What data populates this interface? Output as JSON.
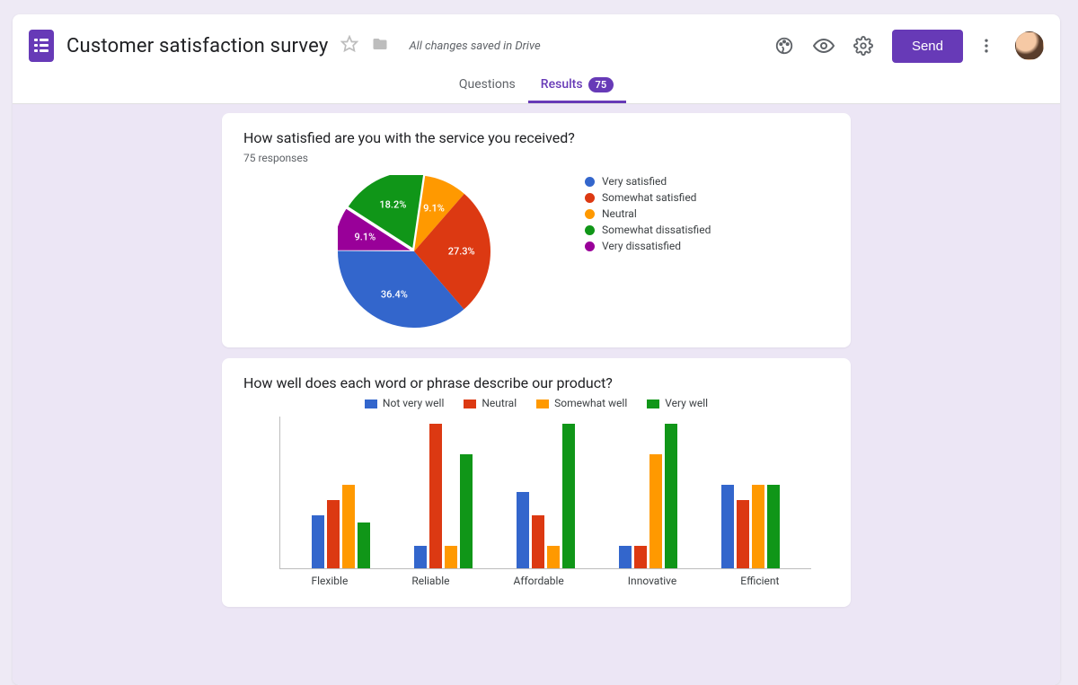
{
  "header": {
    "title": "Customer satisfaction survey",
    "save_status": "All changes saved in Drive",
    "send_label": "Send"
  },
  "tabs": {
    "questions": "Questions",
    "results": "Results",
    "results_badge": "75"
  },
  "q1": {
    "title": "How satisfied are you with the service you received?",
    "responses_label": "75 responses"
  },
  "q2": {
    "title": "How well does each word or phrase describe our product?"
  },
  "colors": {
    "blue": "#3366cc",
    "red": "#dc3912",
    "orange": "#ff9900",
    "green": "#109618",
    "purple": "#990099"
  },
  "chart_data": [
    {
      "type": "pie",
      "title": "How satisfied are you with the service you received?",
      "series": [
        {
          "name": "Very satisfied",
          "value": 36.4,
          "color": "blue",
          "label": "36.4%"
        },
        {
          "name": "Somewhat satisfied",
          "value": 27.3,
          "color": "red",
          "label": "27.3%"
        },
        {
          "name": "Neutral",
          "value": 9.1,
          "color": "orange",
          "label": "9.1%"
        },
        {
          "name": "Somewhat dissatisfied",
          "value": 18.2,
          "color": "green",
          "label": "18.2%"
        },
        {
          "name": "Very dissatisfied",
          "value": 9.1,
          "color": "purple",
          "label": "9.1%"
        }
      ]
    },
    {
      "type": "bar",
      "title": "How well does each word or phrase describe our product?",
      "categories": [
        "Flexible",
        "Reliable",
        "Affordable",
        "Innovative",
        "Efficient"
      ],
      "series": [
        {
          "name": "Not very well",
          "color": "blue",
          "values": [
            35,
            15,
            50,
            15,
            55
          ]
        },
        {
          "name": "Neutral",
          "color": "red",
          "values": [
            45,
            95,
            35,
            15,
            45
          ]
        },
        {
          "name": "Somewhat well",
          "color": "orange",
          "values": [
            55,
            15,
            15,
            75,
            55
          ]
        },
        {
          "name": "Very well",
          "color": "green",
          "values": [
            30,
            75,
            95,
            95,
            55
          ]
        }
      ],
      "ylim": [
        0,
        100
      ]
    }
  ]
}
